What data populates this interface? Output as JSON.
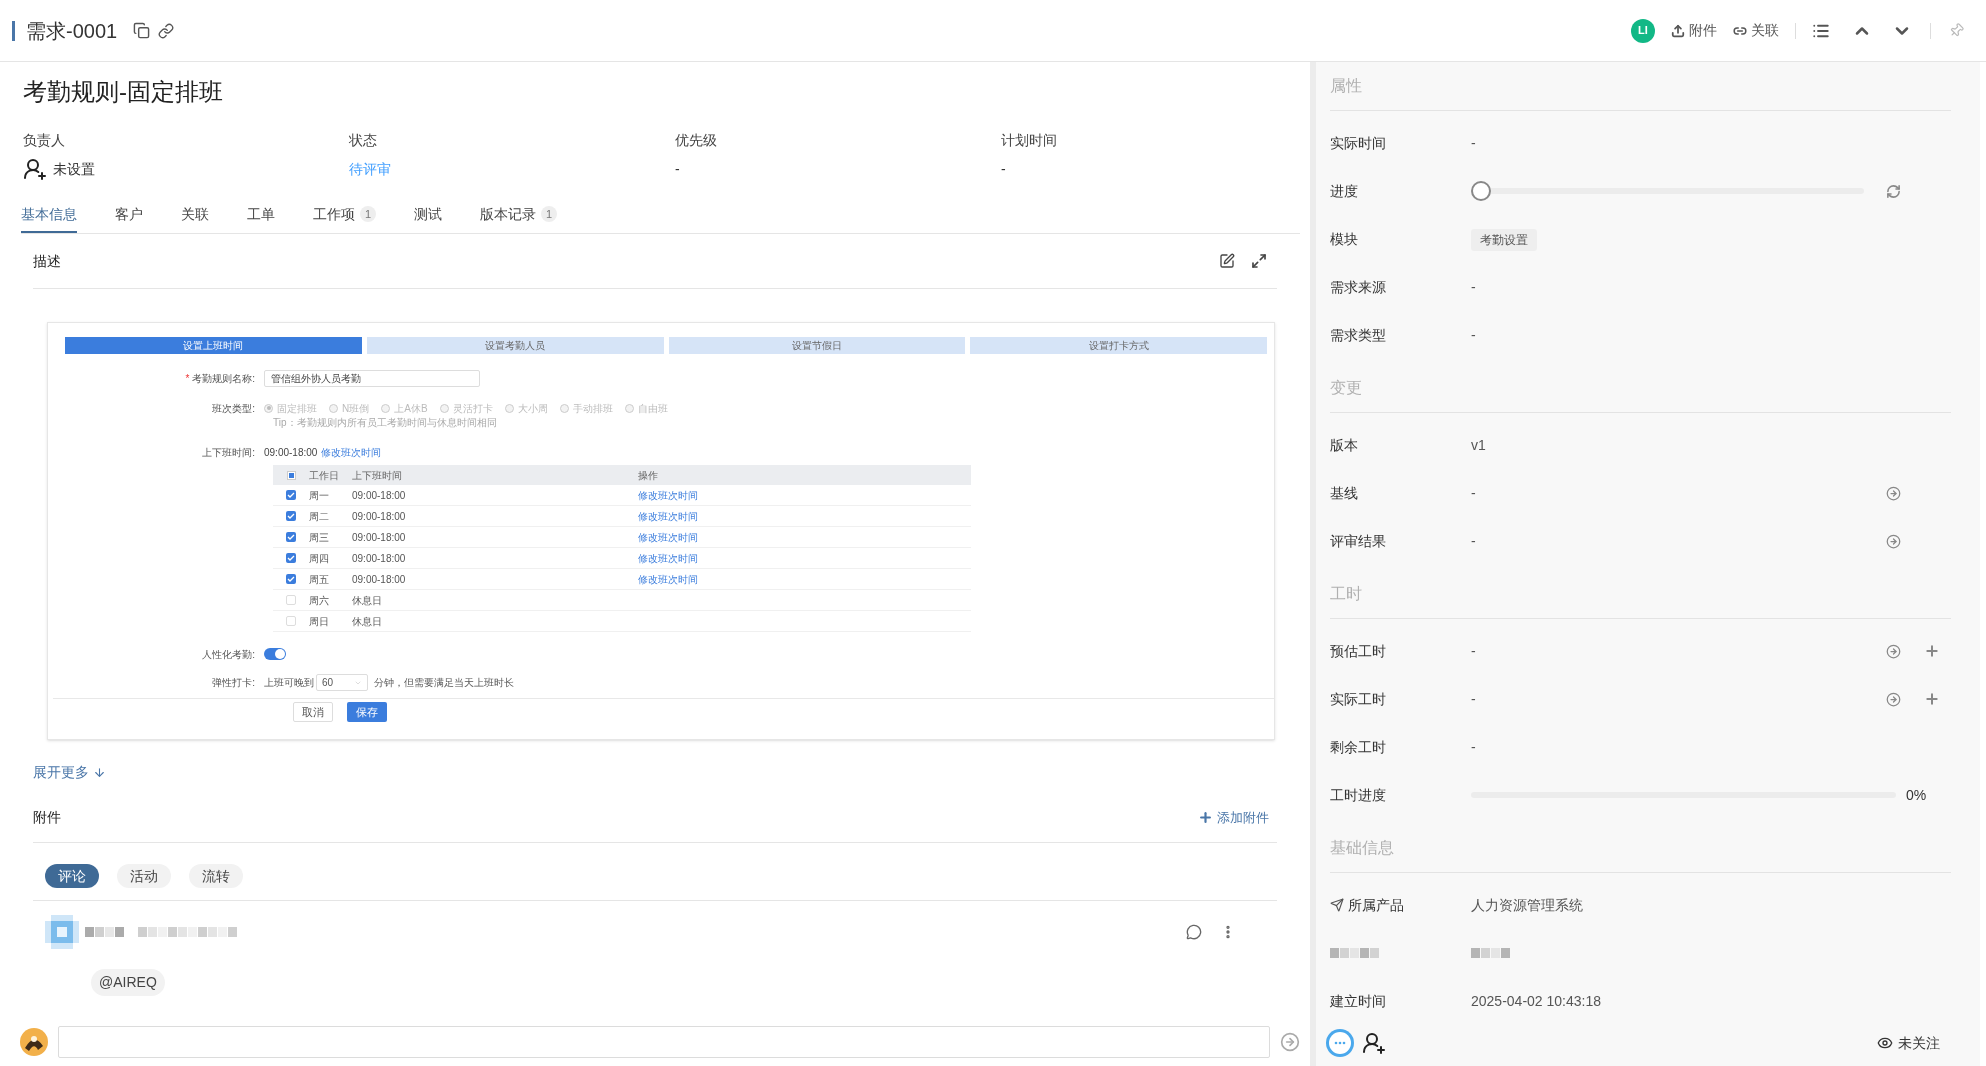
{
  "header": {
    "id": "需求-0001",
    "avatar": "LI",
    "actions": [
      {
        "label": "附件",
        "kind": "upload"
      },
      {
        "label": "关联",
        "kind": "link"
      }
    ]
  },
  "title": "考勤规则-固定排班",
  "fields": [
    {
      "label": "负责人",
      "value": "未设置",
      "kind": "user"
    },
    {
      "label": "状态",
      "value": "待评审",
      "kind": "status"
    },
    {
      "label": "优先级",
      "value": "-",
      "kind": "text"
    },
    {
      "label": "计划时间",
      "value": "-",
      "kind": "text"
    }
  ],
  "tabs": [
    {
      "label": "基本信息",
      "selected": true
    },
    {
      "label": "客户",
      "selected": false
    },
    {
      "label": "关联",
      "selected": false
    },
    {
      "label": "工单",
      "selected": false
    },
    {
      "label": "工作项",
      "badge": "1",
      "selected": false
    },
    {
      "label": "测试",
      "selected": false
    },
    {
      "label": "版本记录",
      "badge": "1",
      "selected": false
    }
  ],
  "description": {
    "title": "描述",
    "expand": "展开更多",
    "screenshot": {
      "steps": [
        {
          "label": "设置上班时间",
          "selected": true
        },
        {
          "label": "设置考勤人员",
          "selected": false
        },
        {
          "label": "设置节假日",
          "selected": false
        },
        {
          "label": "设置打卡方式",
          "selected": false
        }
      ],
      "required_mark": "*",
      "name_label": "考勤规则名称:",
      "name_value": "管信组外协人员考勤",
      "shift_label": "班次类型:",
      "shift_options": [
        {
          "label": "固定排班",
          "selected": true
        },
        {
          "label": "N班倒",
          "selected": false
        },
        {
          "label": "上A休B",
          "selected": false
        },
        {
          "label": "灵活打卡",
          "selected": false
        },
        {
          "label": "大小周",
          "selected": false
        },
        {
          "label": "手动排班",
          "selected": false
        },
        {
          "label": "自由班",
          "selected": false
        }
      ],
      "tip": "Tip：考勤规则内所有员工考勤时间与休息时间相同",
      "hours_label": "上下班时间:",
      "hours_value": "09:00-18:00",
      "hours_link": "修改班次时间",
      "header_partial": true,
      "columns": [
        "工作日",
        "上下班时间",
        "操作"
      ],
      "rows": [
        {
          "day": "周一",
          "time": "09:00-18:00",
          "action": "修改班次时间",
          "checked": true
        },
        {
          "day": "周二",
          "time": "09:00-18:00",
          "action": "修改班次时间",
          "checked": true
        },
        {
          "day": "周三",
          "time": "09:00-18:00",
          "action": "修改班次时间",
          "checked": true
        },
        {
          "day": "周四",
          "time": "09:00-18:00",
          "action": "修改班次时间",
          "checked": true
        },
        {
          "day": "周五",
          "time": "09:00-18:00",
          "action": "修改班次时间",
          "checked": true
        },
        {
          "day": "周六",
          "time": "休息日",
          "checked": false
        },
        {
          "day": "周日",
          "time": "休息日",
          "checked": false
        }
      ],
      "humane_label": "人性化考勤:",
      "humane_on": true,
      "flex_label": "弹性打卡:",
      "flex_prefix": "上班可晚到",
      "flex_value": "60",
      "flex_suffix": "分钟，但需要满足当天上班时长",
      "buttons": [
        {
          "label": "取消",
          "kind": "default"
        },
        {
          "label": "保存",
          "kind": "primary"
        }
      ]
    }
  },
  "attachments": {
    "title": "附件",
    "add": "添加附件"
  },
  "activity_tabs": [
    {
      "label": "评论",
      "selected": true
    },
    {
      "label": "活动",
      "selected": false
    },
    {
      "label": "流转",
      "selected": false
    }
  ],
  "comment": {
    "mention": "@AIREQ"
  },
  "properties": [
    {
      "title": "属性",
      "rows": [
        {
          "label": "实际时间",
          "kind": "text",
          "value": "-"
        },
        {
          "label": "进度",
          "kind": "slider",
          "level": 0,
          "actions": [
            {
              "kind": "refresh"
            }
          ]
        },
        {
          "label": "模块",
          "kind": "tag",
          "value": "考勤设置"
        },
        {
          "label": "需求来源",
          "kind": "text",
          "value": "-"
        },
        {
          "label": "需求类型",
          "kind": "text",
          "value": "-"
        }
      ]
    },
    {
      "title": "变更",
      "rows": [
        {
          "label": "版本",
          "kind": "text",
          "value": "v1"
        },
        {
          "label": "基线",
          "kind": "text",
          "value": "-",
          "actions": [
            {
              "kind": "goto"
            }
          ]
        },
        {
          "label": "评审结果",
          "kind": "text",
          "value": "-",
          "actions": [
            {
              "kind": "goto"
            }
          ]
        }
      ]
    },
    {
      "title": "工时",
      "rows": [
        {
          "label": "预估工时",
          "kind": "text",
          "value": "-",
          "actions": [
            {
              "kind": "goto"
            },
            {
              "kind": "add"
            }
          ]
        },
        {
          "label": "实际工时",
          "kind": "text",
          "value": "-",
          "actions": [
            {
              "kind": "goto"
            },
            {
              "kind": "add"
            }
          ]
        },
        {
          "label": "剩余工时",
          "kind": "text",
          "value": "-"
        },
        {
          "label": "工时进度",
          "kind": "progress",
          "level": 0,
          "reading": "0%"
        }
      ]
    },
    {
      "title": "基础信息",
      "rows": [
        {
          "label": "所属产品",
          "kind": "product",
          "value": "人力资源管理系统"
        },
        {
          "kind": "redacted"
        },
        {
          "label": "建立时间",
          "kind": "text",
          "value": "2025-04-02 10:43:18"
        }
      ]
    }
  ],
  "follow": "未关注"
}
